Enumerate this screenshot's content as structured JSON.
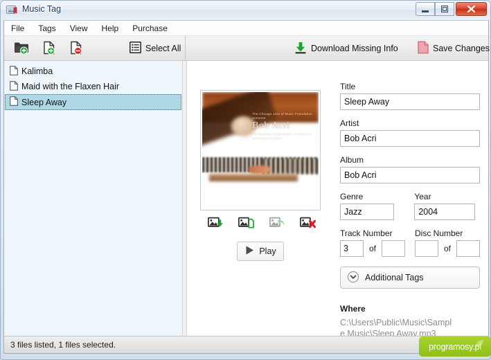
{
  "window": {
    "title": "Music Tag",
    "app_icon": "photo-tag-icon",
    "controls": {
      "minimize": "minimize-icon",
      "maximize": "maximize-icon",
      "close": "close-icon"
    }
  },
  "menu": {
    "items": [
      {
        "label": "File"
      },
      {
        "label": "Tags"
      },
      {
        "label": "View"
      },
      {
        "label": "Help"
      },
      {
        "label": "Purchase"
      }
    ]
  },
  "toolbar": {
    "left": [
      {
        "name": "add-folder-button",
        "icon": "folder-add-icon",
        "label": ""
      },
      {
        "name": "add-file-button",
        "icon": "file-add-icon",
        "label": ""
      },
      {
        "name": "remove-file-button",
        "icon": "file-remove-icon",
        "label": ""
      },
      {
        "name": "select-all-button",
        "icon": "list-icon",
        "label": "Select All"
      }
    ],
    "right": [
      {
        "name": "download-missing-info-button",
        "icon": "download-icon",
        "label": "Download Missing Info"
      },
      {
        "name": "save-changes-button",
        "icon": "save-file-icon",
        "label": "Save Changes"
      }
    ]
  },
  "file_list": {
    "items": [
      {
        "label": "Kalimba",
        "icon": "file-icon",
        "selected": false
      },
      {
        "label": "Maid with the Flaxen Hair",
        "icon": "file-icon",
        "selected": false
      },
      {
        "label": "Sleep Away",
        "icon": "file-icon",
        "selected": true
      }
    ]
  },
  "artwork": {
    "cover_title": "Bob Acri",
    "cover_line1": "The Chicago Jazz of\nMusic Foundation presents",
    "cover_line2": "with Diane Delin, George Fludas, Lew Soloff, Eric Hochberg & Frank Mose",
    "actions": [
      {
        "name": "download-artwork-button",
        "icon": "image-download-icon"
      },
      {
        "name": "copy-artwork-button",
        "icon": "image-copy-icon"
      },
      {
        "name": "restore-artwork-button",
        "icon": "image-restore-icon",
        "disabled": true
      },
      {
        "name": "delete-artwork-button",
        "icon": "image-delete-icon"
      }
    ]
  },
  "play": {
    "label": "Play",
    "icon": "play-icon"
  },
  "form": {
    "title": {
      "label": "Title",
      "value": "Sleep Away",
      "placeholder": ""
    },
    "artist": {
      "label": "Artist",
      "value": "Bob Acri",
      "placeholder": ""
    },
    "album": {
      "label": "Album",
      "value": "Bob Acri",
      "placeholder": ""
    },
    "genre": {
      "label": "Genre",
      "value": "Jazz",
      "placeholder": ""
    },
    "year": {
      "label": "Year",
      "value": "2004",
      "placeholder": ""
    },
    "track_number": {
      "label": "Track Number",
      "value": "3",
      "separator": "of",
      "total": ""
    },
    "disc_number": {
      "label": "Disc Number",
      "value": "",
      "separator": "of",
      "total": ""
    },
    "additional_tags": {
      "label": "Additional Tags",
      "icon": "chevron-down-circle-icon",
      "expanded": false
    },
    "where": {
      "label": "Where",
      "path": "C:\\Users\\Public\\Music\\Sample Music\\Sleep Away.mp3"
    }
  },
  "statusbar": {
    "text": "3 files listed, 1 files selected.",
    "watermark": "programosy.pl"
  },
  "colors": {
    "selection": "#aed8e6",
    "left_panel": "#eef5fb",
    "accent_green": "#18a02a",
    "accent_red": "#d62020",
    "watermark_green": "#9ccd24",
    "title_text": "#1c3c62"
  }
}
